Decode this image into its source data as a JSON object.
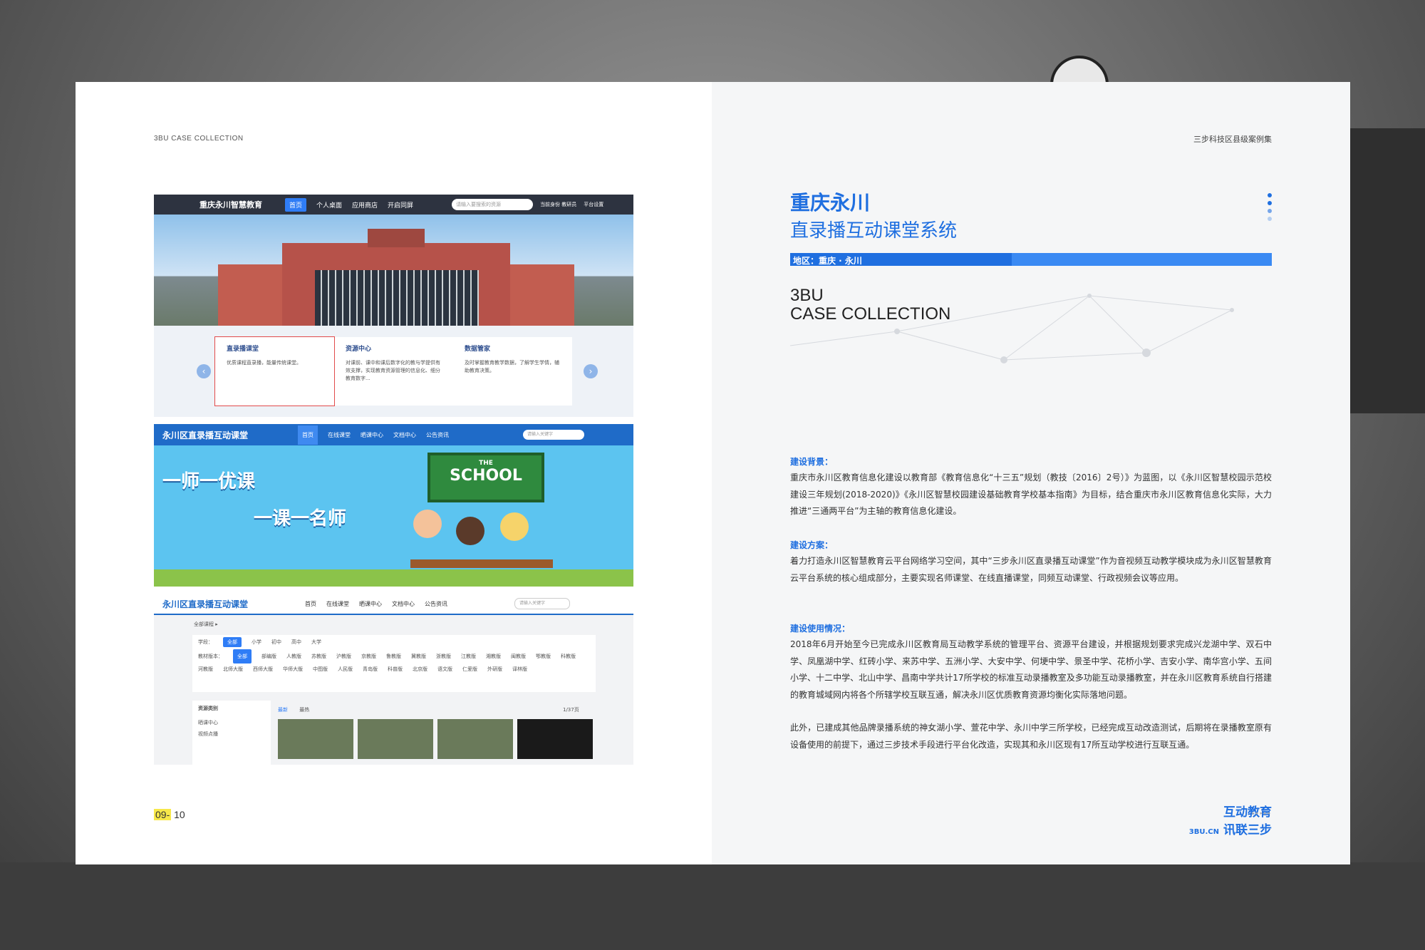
{
  "left": {
    "header": "3BU CASE COLLECTION",
    "page_hl": "09-",
    "page_rest": " 10",
    "shot1": {
      "logo": "重庆永川智慧教育",
      "nav": [
        "首页",
        "个人桌面",
        "应用商店",
        "开启同屏"
      ],
      "search": "请输入要搜索的资源",
      "user": "当前身份 教研员",
      "platform": "平台设置",
      "cards": [
        {
          "title": "直录播课堂",
          "desc": "优质课程直录播，能量传统课堂。"
        },
        {
          "title": "资源中心",
          "desc": "对课前、课中和课后数字化的教与学提供有效支撑，实现教育资源管理的信息化、细分教育数字..."
        },
        {
          "title": "数据管家",
          "desc": "及时掌握教育教学数据，了解学生学情，辅助教育决策。"
        }
      ]
    },
    "shot2": {
      "logo": "永川区直录播互动课堂",
      "nav": [
        "首页",
        "在线课堂",
        "晒课中心",
        "文档中心",
        "公告资讯"
      ],
      "search": "请输入关键字",
      "slogan1": "一师一优课",
      "slogan2": "一课一名师",
      "board_a": "THE",
      "board_b": "SCHOOL"
    },
    "shot3": {
      "logo": "永川区直录播互动课堂",
      "nav": [
        "首页",
        "在线课堂",
        "晒课中心",
        "文档中心",
        "公告资讯"
      ],
      "search": "请输入关键字",
      "crumb": "全部课程 ▸",
      "stage_label": "学段：",
      "stages": [
        "全部",
        "小学",
        "初中",
        "高中",
        "大学"
      ],
      "edition_label": "教材版本：",
      "editions": [
        "全部",
        "部编版",
        "人教版",
        "苏教版",
        "沪教版",
        "京教版",
        "鲁教版",
        "冀教版",
        "浙教版",
        "江教版",
        "湘教版",
        "闽教版",
        "鄂教版",
        "科教版",
        "河教版",
        "北师大版",
        "西师大版",
        "华师大版",
        "中图版",
        "人民版",
        "青岛版",
        "科普版",
        "北京版",
        "语文版",
        "仁爱版",
        "外研版",
        "译林版"
      ],
      "side_title": "资源类别",
      "side_items": [
        "晒课中心",
        "视频点播"
      ],
      "tabs": [
        "最新",
        "最热"
      ],
      "pager": "1/37页"
    }
  },
  "right": {
    "header": "三步科技区县级案例集",
    "title1": "重庆永川",
    "title2": "直录播互动课堂系统",
    "region": "地区：重庆 · 永川",
    "en1": "3BU",
    "en2": "CASE COLLECTION",
    "sections": [
      {
        "h": "建设背景：",
        "p": "重庆市永川区教育信息化建设以教育部《教育信息化“十三五”规划（教技〔2016〕2号）》为蓝图，以《永川区智慧校园示范校建设三年规划(2018-2020)》《永川区智慧校园建设基础教育学校基本指南》为目标，结合重庆市永川区教育信息化实际，大力推进“三通两平台”为主轴的教育信息化建设。"
      },
      {
        "h": "建设方案：",
        "p": "着力打造永川区智慧教育云平台网络学习空间，其中“三步永川区直录播互动课堂”作为音视频互动教学模块成为永川区智慧教育云平台系统的核心组成部分，主要实现名师课堂、在线直播课堂，同频互动课堂、行政视频会议等应用。"
      },
      {
        "h": "建设使用情况：",
        "p": "2018年6月开始至今已完成永川区教育局互动教学系统的管理平台、资源平台建设，并根据规划要求完成兴龙湖中学、双石中学、凤凰湖中学、红砖小学、来苏中学、五洲小学、大安中学、何埂中学、景圣中学、花桥小学、吉安小学、南华宫小学、五间小学、十二中学、北山中学、昌南中学共计17所学校的标准互动录播教室及多功能互动录播教室，并在永川区教育系统自行搭建的教育城域网内将各个所辖学校互联互通，解决永川区优质教育资源均衡化实际落地问题。",
        "p2": "此外，已建成其他品牌录播系统的神女湖小学、萱花中学、永川中学三所学校，已经完成互动改造测试，后期将在录播教室原有设备使用的前提下，通过三步技术手段进行平台化改造，实现其和永川区现有17所互动学校进行互联互通。"
      }
    ],
    "brand1": "互动教育",
    "brand2": "讯联三步",
    "brand_en": "3BU.CN",
    "accent": "#1f6fe0"
  }
}
